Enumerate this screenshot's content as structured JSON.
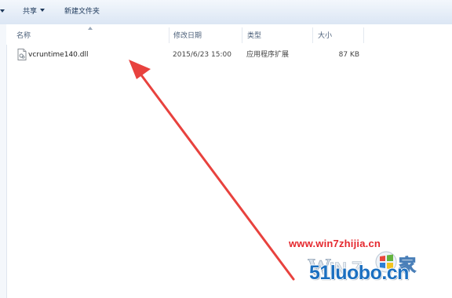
{
  "toolbar": {
    "share_label": "共享",
    "newfolder_label": "新建文件夹"
  },
  "columns": {
    "name": "名称",
    "date": "修改日期",
    "type": "类型",
    "size": "大小"
  },
  "files": [
    {
      "name": "vcruntime140.dll",
      "modified": "2015/6/23 15:00",
      "type": "应用程序扩展",
      "size": "87 KB"
    }
  ],
  "watermark": {
    "url": "www.win7zhijia.cn",
    "logo_text": "Win7 之家",
    "domain": "51luobo.cn"
  },
  "colors": {
    "arrow": "#e8423e",
    "watermark_red": "#e5282e",
    "watermark_blue": "#1b6fc0"
  }
}
